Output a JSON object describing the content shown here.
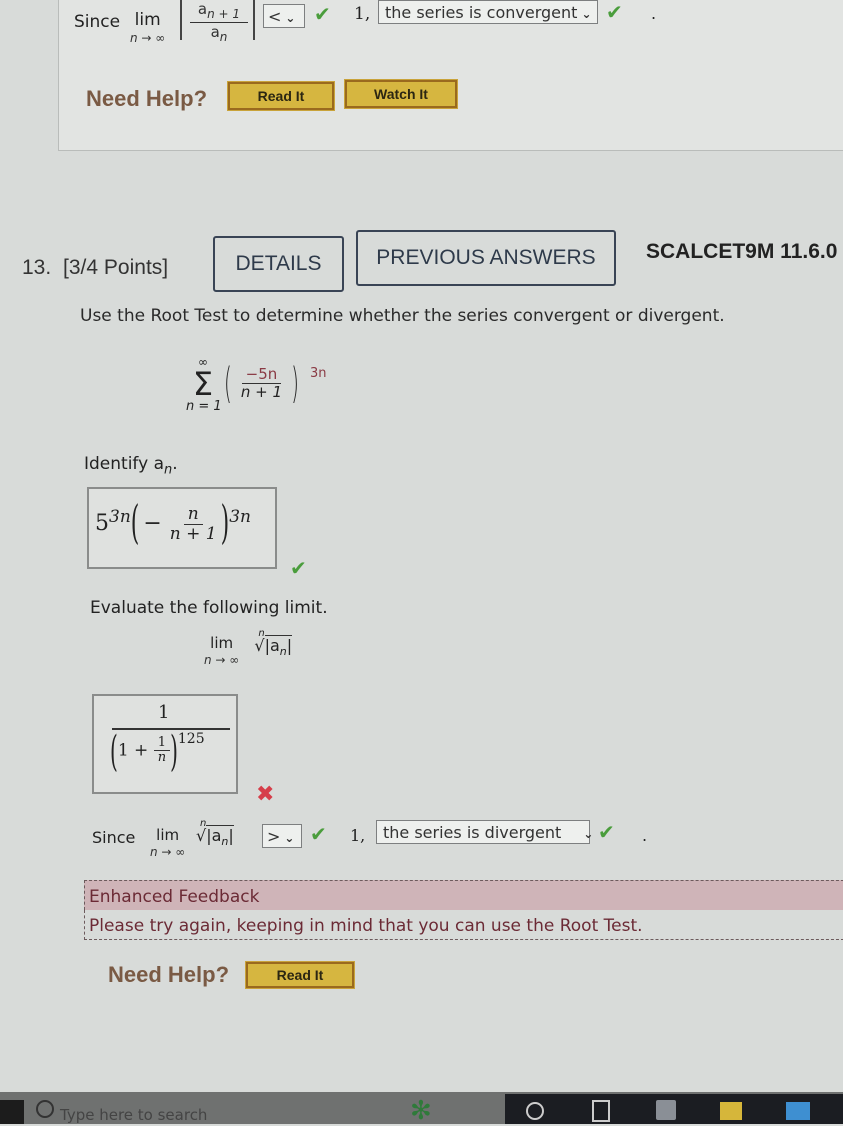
{
  "previous_question": {
    "since_label": "Since",
    "lim_label": "lim",
    "lim_sub": "n → ∞",
    "ratio_numerator": "a",
    "ratio_numerator_sub": "n + 1",
    "ratio_denominator": "a",
    "ratio_denominator_sub": "n",
    "comparison_select": "<",
    "one_label": "1,",
    "conclusion_select": "the series is convergent",
    "period": ".",
    "need_help": "Need Help?",
    "read_it": "Read It",
    "watch_it": "Watch It"
  },
  "question": {
    "number": "13.",
    "points": "[3/4 Points]",
    "details_button": "DETAILS",
    "previous_answers_button": "PREVIOUS ANSWERS",
    "course_code": "SCALCET9M 11.6.0",
    "prompt": "Use the Root Test to determine whether the series convergent or divergent.",
    "series": {
      "sum_top": "∞",
      "sum_bottom": "n = 1",
      "numerator": "−5n",
      "denominator": "n + 1",
      "exponent": "3n"
    },
    "identify_label": "Identify a",
    "identify_sub": "n",
    "identify_period": ".",
    "answer_an": {
      "base": "5",
      "base_exp": "3n",
      "minus": "−",
      "numerator": "n",
      "denominator": "n + 1",
      "exponent": "3n",
      "status": "correct"
    },
    "evaluate_label": "Evaluate the following limit.",
    "limit_expr": {
      "lim": "lim",
      "lim_sub": "n → ∞",
      "root_index": "n",
      "radicand": "|a",
      "radicand_sub": "n",
      "radicand_close": "|"
    },
    "answer_limit": {
      "numerator": "1",
      "inner_one": "1 +",
      "inner_frac_num": "1",
      "inner_frac_den": "n",
      "exponent": "125",
      "status": "incorrect"
    },
    "since_line": {
      "since_label": "Since",
      "lim": "lim",
      "lim_sub": "n → ∞",
      "root_index": "n",
      "radicand": "|a",
      "radicand_sub": "n",
      "radicand_close": "|",
      "comparison_select": ">",
      "one_label": "1,",
      "conclusion_select": "the series is divergent",
      "period": "."
    },
    "feedback": {
      "title": "Enhanced Feedback",
      "message": "Please try again, keeping in mind that you can use the Root Test."
    },
    "need_help": "Need Help?",
    "read_it": "Read It"
  },
  "taskbar": {
    "search_placeholder": "Type here to search",
    "icons": [
      "windows-start-icon",
      "search-icon",
      "cortana-icon",
      "task-view-icon",
      "store-icon",
      "file-explorer-icon",
      "mail-icon"
    ]
  },
  "colors": {
    "correct": "#4a9d3c",
    "incorrect": "#d63e4a",
    "help_button": "#d6b640",
    "feedback_bg": "#cfb4b8"
  }
}
